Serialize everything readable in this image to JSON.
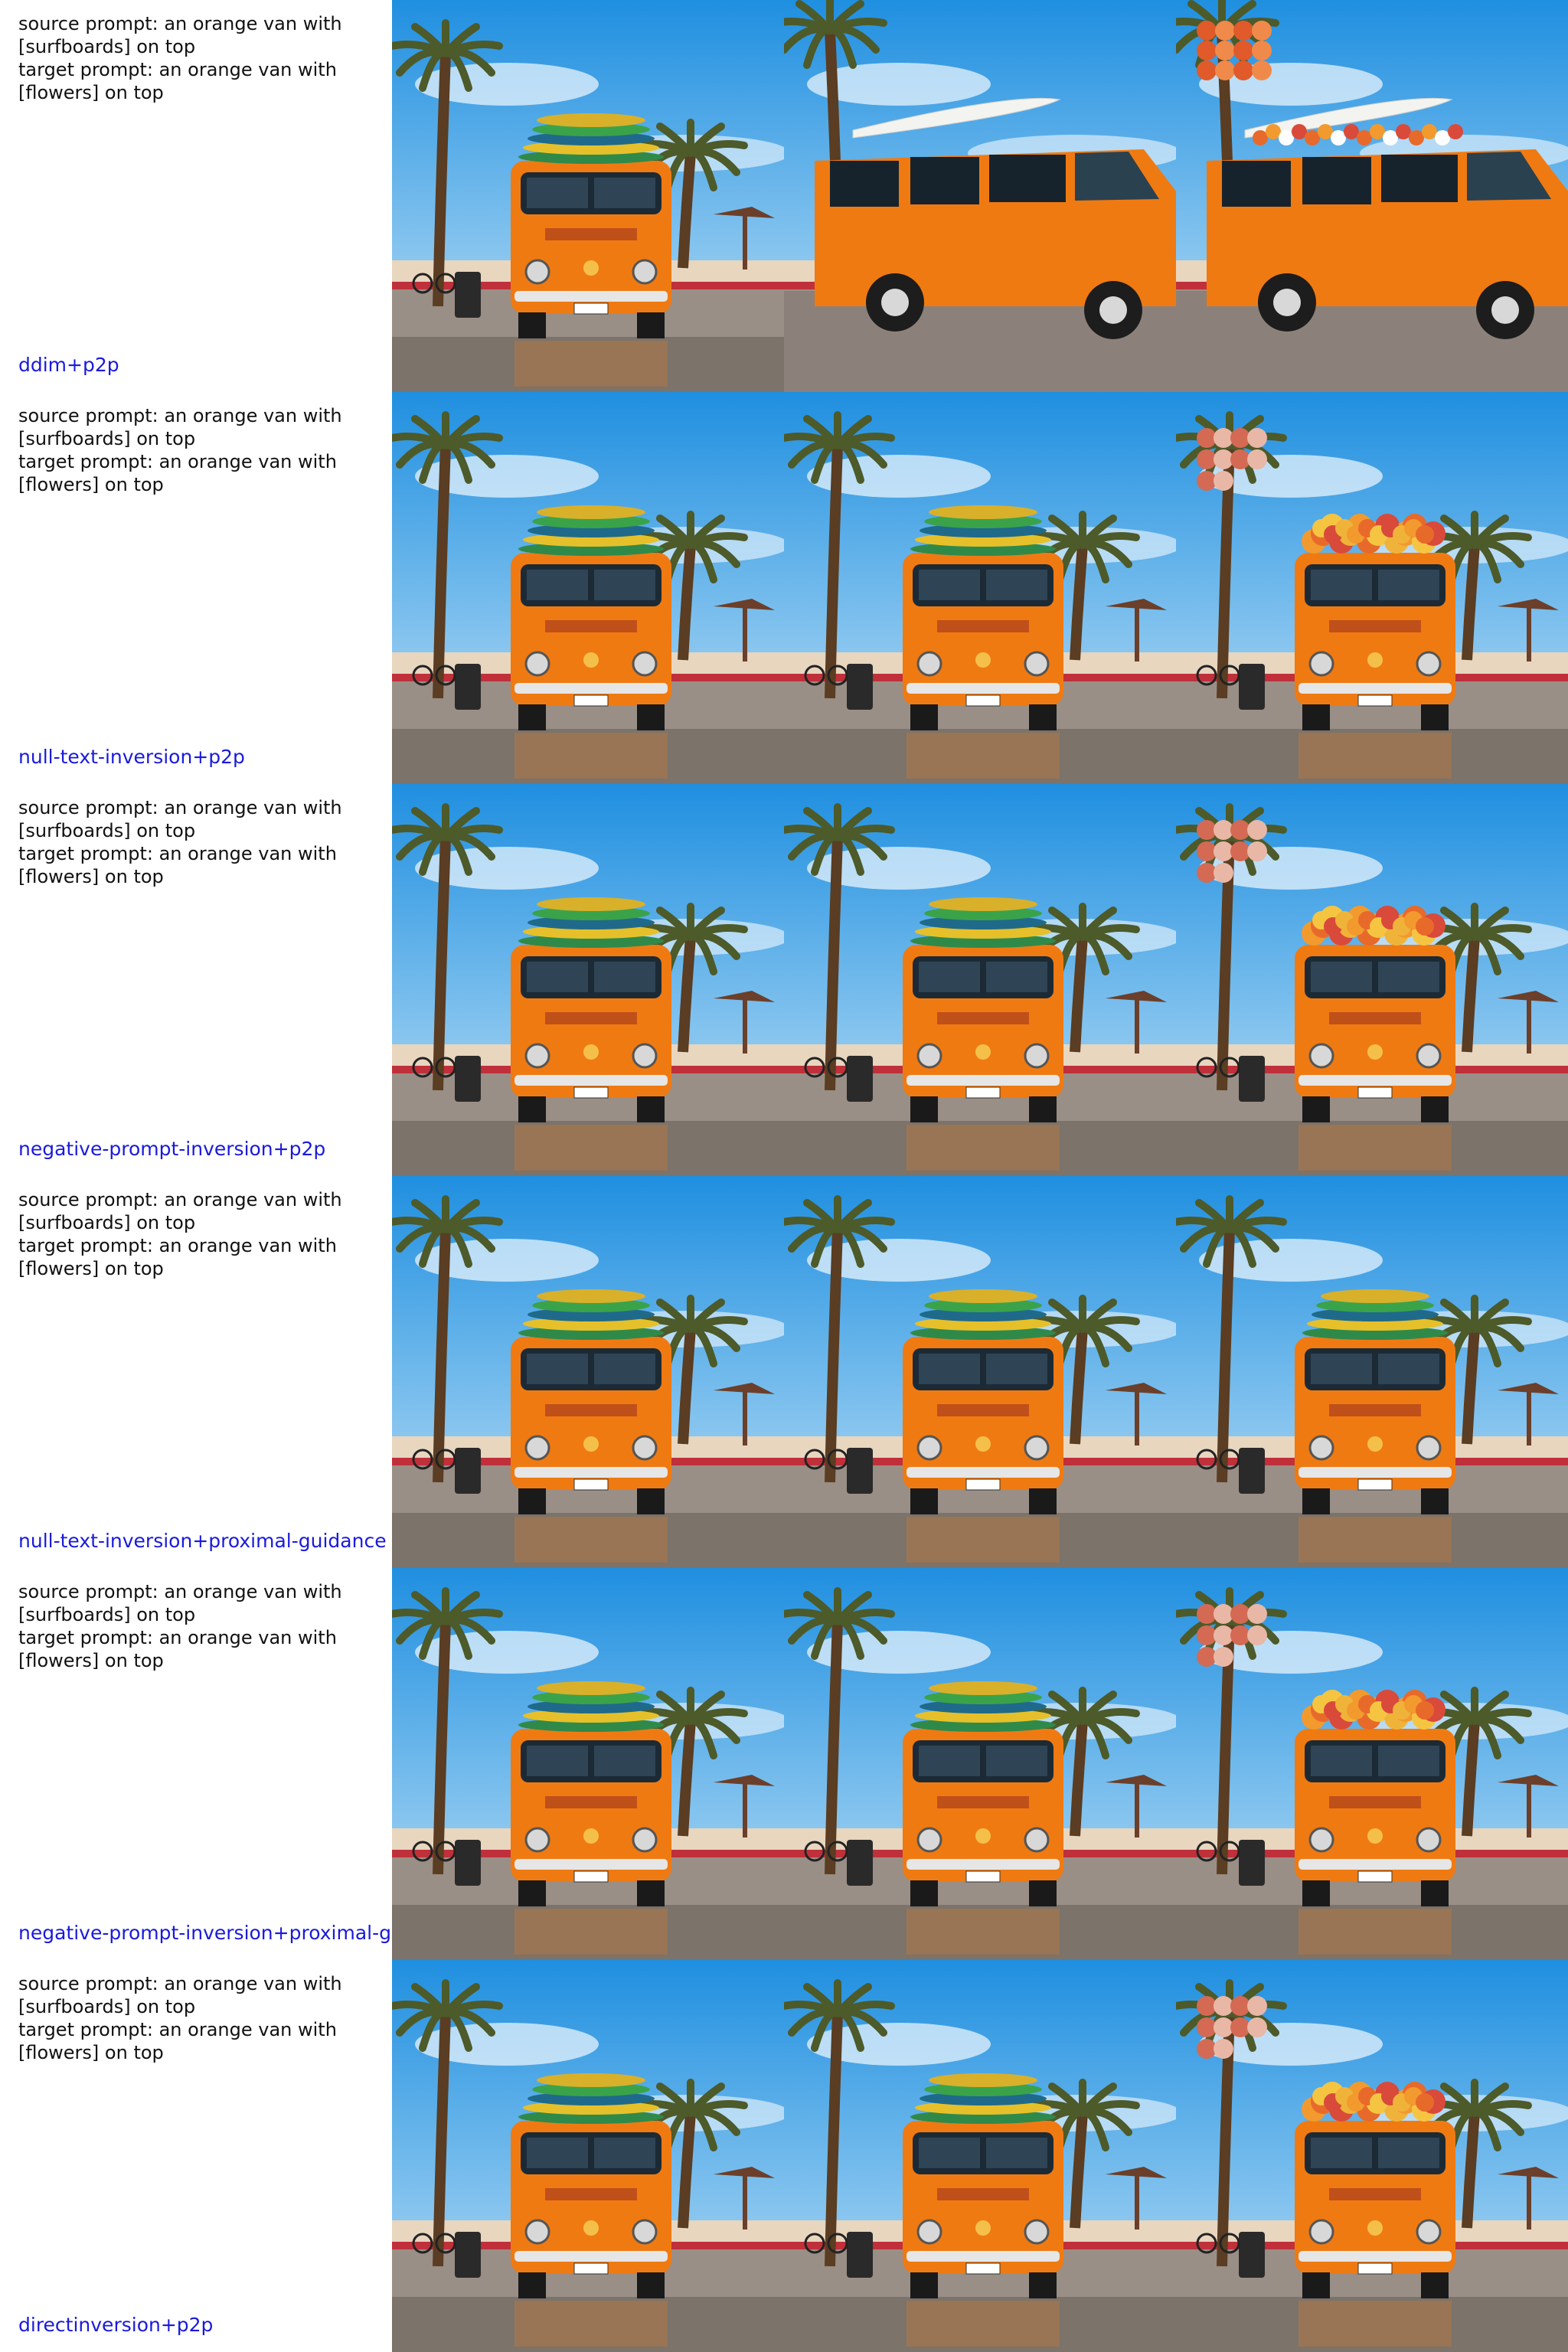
{
  "rows": [
    {
      "source": "source prompt: an orange van with [surfboards] on top",
      "target": "target prompt: an orange van with [flowers] on top",
      "method": "ddim+p2p",
      "variants": [
        "bus",
        "side-van",
        "side-van-flowers"
      ]
    },
    {
      "source": "source prompt: an orange van with [surfboards] on top",
      "target": "target prompt: an orange van with [flowers] on top",
      "method": "null-text-inversion+p2p",
      "variants": [
        "bus",
        "bus",
        "bus-flowers"
      ]
    },
    {
      "source": "source prompt: an orange van with [surfboards] on top",
      "target": "target prompt: an orange van with [flowers] on top",
      "method": "negative-prompt-inversion+p2p",
      "variants": [
        "bus",
        "bus",
        "bus-flowers"
      ]
    },
    {
      "source": "source prompt: an orange van with [surfboards] on top",
      "target": "target prompt: an orange van with [flowers] on top",
      "method": "null-text-inversion+proximal-guidance",
      "variants": [
        "bus",
        "bus",
        "bus"
      ]
    },
    {
      "source": "source prompt: an orange van with [surfboards] on top",
      "target": "target prompt: an orange van with [flowers] on top",
      "method": "negative-prompt-inversion+proximal-g",
      "variants": [
        "bus",
        "bus",
        "bus-flowers"
      ]
    },
    {
      "source": "source prompt: an orange van with [surfboards] on top",
      "target": "target prompt: an orange van with [flowers] on top",
      "method": "directinversion+p2p",
      "variants": [
        "bus",
        "bus",
        "bus-flowers"
      ]
    }
  ],
  "colors": {
    "method_label": "#1a1adc",
    "van": "#f07a12",
    "sky": "#3aa6e6"
  }
}
